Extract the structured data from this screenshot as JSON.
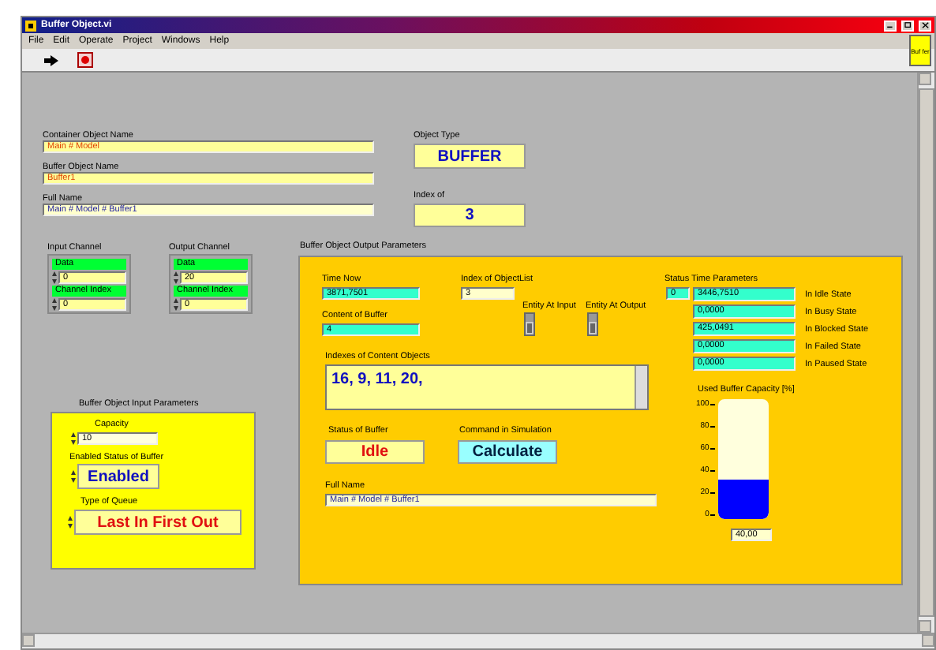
{
  "window": {
    "title": "Buffer Object.vi"
  },
  "menu": [
    "File",
    "Edit",
    "Operate",
    "Project",
    "Windows",
    "Help"
  ],
  "vi_icon_text": "Buf fer",
  "container_object_name": {
    "label": "Container Object Name",
    "value": "Main # Model"
  },
  "buffer_object_name": {
    "label": "Buffer Object Name",
    "value": "Buffer1"
  },
  "full_name": {
    "label": "Full Name",
    "value": "Main # Model # Buffer1"
  },
  "object_type": {
    "label": "Object Type",
    "value": "BUFFER"
  },
  "index_of": {
    "label": "Index of",
    "value": "3"
  },
  "channels": [
    {
      "label": "Input Channel",
      "data_label": "Data",
      "data": "0",
      "index_label": "Channel Index",
      "index": "0"
    },
    {
      "label": "Output Channel",
      "data_label": "Data",
      "data": "20",
      "index_label": "Channel Index",
      "index": "0"
    }
  ],
  "input_params": {
    "title": "Buffer Object Input Parameters",
    "capacity_label": "Capacity",
    "capacity": "10",
    "enabled_label": "Enabled Status of Buffer",
    "enabled": "Enabled",
    "queue_label": "Type of Queue",
    "queue": "Last In First Out"
  },
  "output_params": {
    "title": "Buffer Object Output Parameters",
    "time_now_label": "Time Now",
    "time_now": "3871,7501",
    "content_label": "Content of Buffer",
    "content": "4",
    "objectlist_label": "Index of ObjectList",
    "objectlist": "3",
    "entity_input_label": "Entity At Input",
    "entity_input_on": false,
    "entity_output_label": "Entity At Output",
    "entity_output_on": false,
    "indexes_label": "Indexes of Content Objects",
    "indexes": "16, 9, 11, 20,",
    "status_label": "Status of Buffer",
    "status": "Idle",
    "command_label": "Command in Simulation",
    "command": "Calculate",
    "full_name_label": "Full Name",
    "full_name": "Main # Model # Buffer1",
    "status_time": {
      "label": "Status Time Parameters",
      "index": "0",
      "rows": [
        {
          "value": "3446,7510",
          "label": "In Idle State"
        },
        {
          "value": "0,0000",
          "label": "In Busy State"
        },
        {
          "value": "425,0491",
          "label": "In Blocked State"
        },
        {
          "value": "0,0000",
          "label": "In Failed State"
        },
        {
          "value": "0,0000",
          "label": "In Paused State"
        }
      ]
    },
    "capacity": {
      "label": "Used Buffer Capacity [%]",
      "scale": [
        "100",
        "80",
        "60",
        "40",
        "20",
        "0"
      ],
      "level": 0.33,
      "reading": "40,00"
    }
  }
}
